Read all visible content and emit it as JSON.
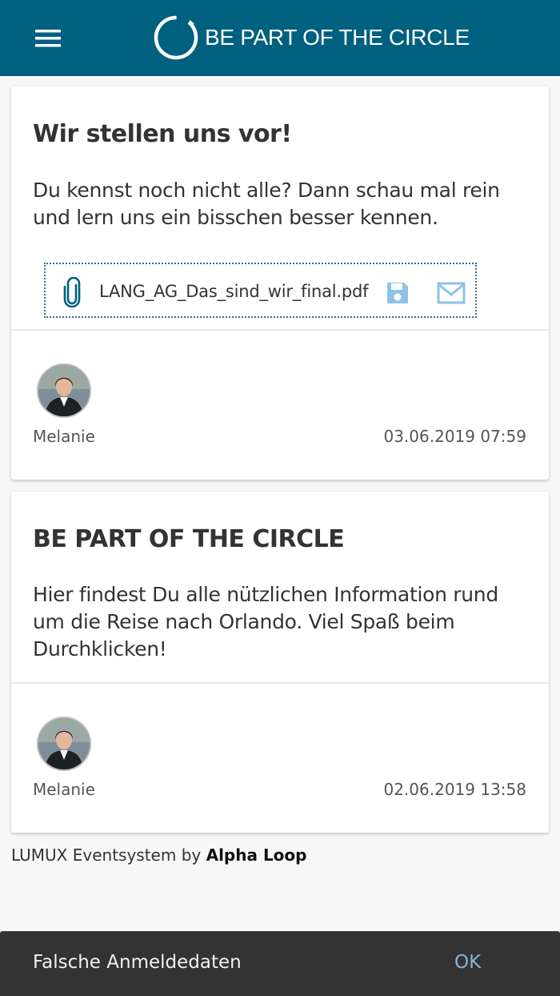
{
  "header": {
    "menu_icon": "hamburger-menu-icon",
    "brand_icon": "circle-logo-icon",
    "brand_text": "BE PART OF THE CIRCLE",
    "bg_color": "#00607f"
  },
  "posts": [
    {
      "title": "Wir stellen uns vor!",
      "text": "Du kennst noch nicht alle? Dann schau mal rein und lern uns ein bisschen besser kennen.",
      "attachment": {
        "icon": "paperclip-icon",
        "file_name": "LANG_AG_Das_sind_wir_final.pdf",
        "save_icon": "floppy-disk-icon",
        "mail_icon": "envelope-icon"
      },
      "author": "Melanie",
      "timestamp": "03.06.2019 07:59"
    },
    {
      "title": "BE PART OF THE CIRCLE",
      "text": "Hier findest Du alle nützlichen Information rund um die Reise nach Orlando. Viel Spaß beim Durchklicken!",
      "author": "Melanie",
      "timestamp": "02.06.2019 13:58"
    }
  ],
  "footer": {
    "credit_prefix": "LUMUX Eventsystem by ",
    "credit_brand": "Alpha Loop"
  },
  "snackbar": {
    "message": "Falsche Anmeldedaten",
    "action": "OK",
    "action_color": "#8ab4d4"
  }
}
